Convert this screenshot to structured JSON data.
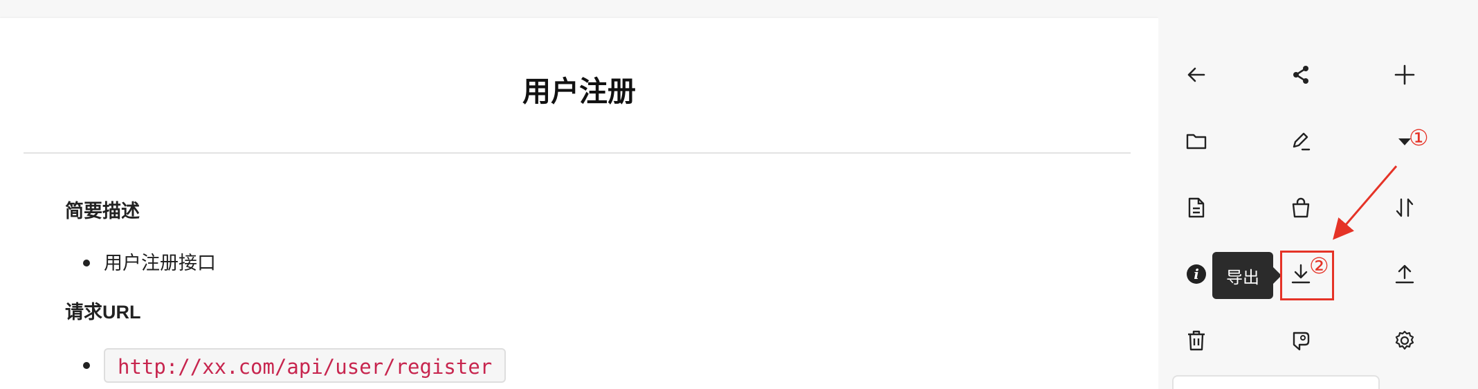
{
  "document": {
    "title": "用户注册",
    "sections": [
      {
        "heading": "简要描述",
        "items": [
          "用户注册接口"
        ]
      },
      {
        "heading": "请求URL",
        "code_items": [
          "http://xx.com/api/user/register"
        ]
      }
    ]
  },
  "toolbar": {
    "tooltip_label": "导出",
    "icons": [
      "back-arrow-icon",
      "share-icon",
      "plus-icon",
      "folder-icon",
      "edit-pen-icon",
      "caret-down-icon",
      "document-icon",
      "bag-icon",
      "sort-arrows-icon",
      "info-icon",
      "export-download-icon",
      "upload-icon",
      "trash-icon",
      "tag-icon",
      "gear-icon"
    ]
  },
  "annotations": {
    "marker_1": "①",
    "marker_2": "②",
    "color": "#e53327"
  },
  "colors": {
    "code_text": "#c7254e",
    "annotation": "#e53327",
    "tooltip_bg": "#2b2b2b"
  }
}
